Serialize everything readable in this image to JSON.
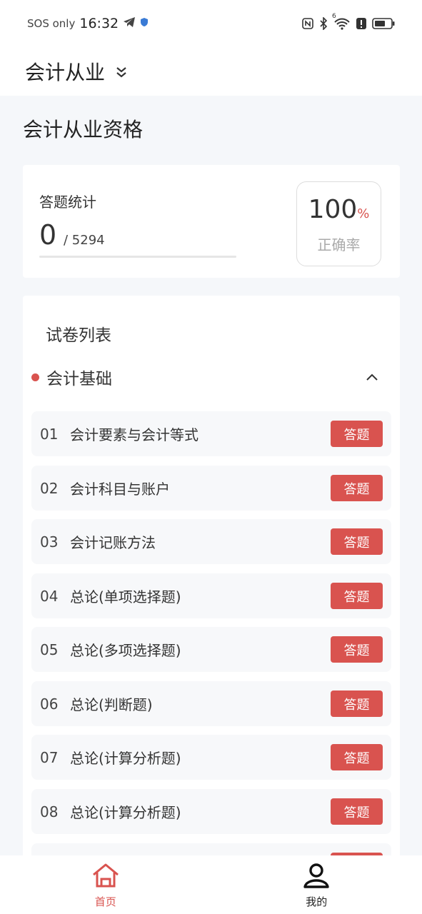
{
  "status_bar": {
    "carrier": "SOS only",
    "time": "16:32",
    "icons": [
      "telegram-icon",
      "shield-icon",
      "nfc-icon",
      "bluetooth-icon",
      "wifi-icon",
      "alert-icon",
      "battery-icon"
    ],
    "wifi_badge": "6"
  },
  "header": {
    "title": "会计从业",
    "dropdown_icon": "double-chevron-down-icon"
  },
  "section_title": "会计从业资格",
  "stats": {
    "label": "答题统计",
    "answered": "0",
    "total": "/ 5294",
    "progress": 0,
    "rate_value": "100",
    "rate_unit": "%",
    "rate_label": "正确率"
  },
  "list": {
    "title": "试卷列表",
    "group": {
      "name": "会计基础",
      "toggle_icon": "chevron-up-icon"
    },
    "items": [
      {
        "no": "01",
        "name": "会计要素与会计等式",
        "action": "答题"
      },
      {
        "no": "02",
        "name": "会计科目与账户",
        "action": "答题"
      },
      {
        "no": "03",
        "name": "会计记账方法",
        "action": "答题"
      },
      {
        "no": "04",
        "name": "总论(单项选择题)",
        "action": "答题"
      },
      {
        "no": "05",
        "name": "总论(多项选择题)",
        "action": "答题"
      },
      {
        "no": "06",
        "name": "总论(判断题)",
        "action": "答题"
      },
      {
        "no": "07",
        "name": "总论(计算分析题)",
        "action": "答题"
      },
      {
        "no": "08",
        "name": "总论(计算分析题)",
        "action": "答题"
      }
    ]
  },
  "bottom_nav": {
    "items": [
      {
        "label": "首页",
        "icon": "home-icon",
        "active": true
      },
      {
        "label": "我的",
        "icon": "user-icon",
        "active": false
      }
    ]
  },
  "colors": {
    "accent": "#d9534f",
    "background": "#f5f7fa",
    "card": "#ffffff"
  }
}
